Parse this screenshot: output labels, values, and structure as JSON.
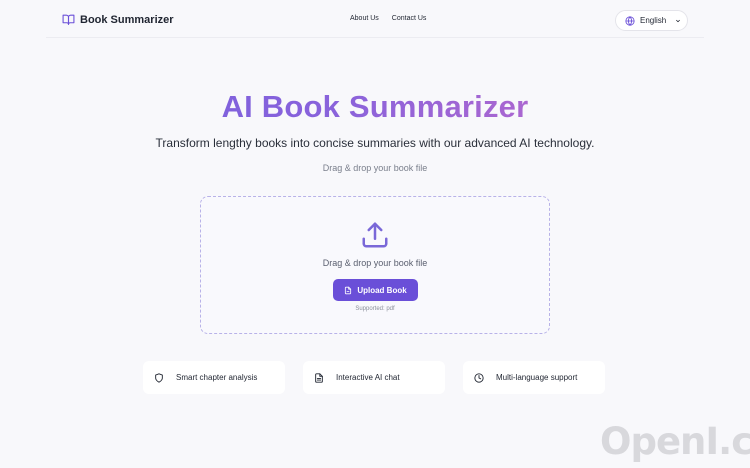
{
  "header": {
    "brand": "Book Summarizer",
    "links": [
      "About Us",
      "Contact Us"
    ],
    "language": "English"
  },
  "hero": {
    "title": "AI Book Summarizer",
    "subtitle": "Transform lengthy books into concise summaries with our advanced AI technology.",
    "drag_hint": "Drag & drop your book file"
  },
  "dropzone": {
    "text": "Drag & drop your book file",
    "button_label": "Upload Book",
    "supported": "Supported: pdf"
  },
  "features": [
    {
      "icon": "shield-icon",
      "label": "Smart chapter analysis"
    },
    {
      "icon": "document-icon",
      "label": "Interactive AI chat"
    },
    {
      "icon": "clock-icon",
      "label": "Multi-language support"
    }
  ],
  "watermark": "OpenI.cn",
  "colors": {
    "accent": "#6a4fd8",
    "gradient_start": "#6f5ee0",
    "gradient_end": "#d06bc4",
    "background": "#f8f8fb"
  }
}
